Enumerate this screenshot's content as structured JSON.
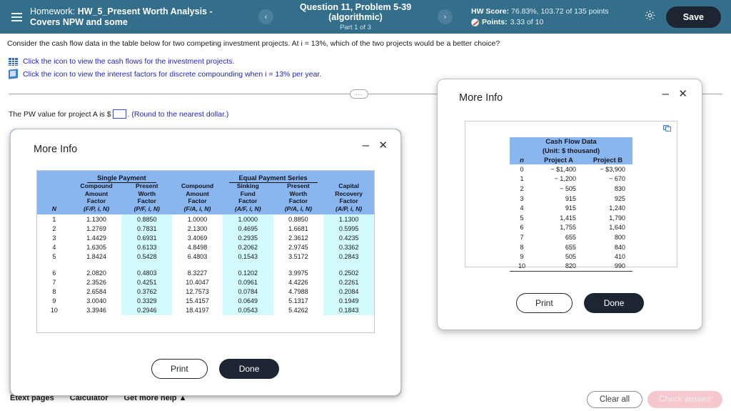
{
  "header": {
    "menu_icon": "hamburger-icon",
    "homework_label": "Homework:",
    "homework_name": "HW_5_Present Worth Analysis - Covers NPW and some",
    "prev_icon": "chevron-left-icon",
    "next_icon": "chevron-right-icon",
    "question_title": "Question 11, Problem 5-39 (algorithmic)",
    "question_part": "Part 1 of 3",
    "hw_score_label": "HW Score:",
    "hw_score_value": "76.83%, 103.72 of 135 points",
    "points_label": "Points:",
    "points_value": "3.33 of 10",
    "settings_icon": "gear-icon",
    "save_label": "Save"
  },
  "question": {
    "prompt": "Consider the cash flow data in the table below for two competing investment projects. At i = 13%, which of the two projects would be a better choice?",
    "link_cashflows": "Click the icon to view the cash flows for the investment projects.",
    "link_interest": "Click the icon to view the interest factors for discrete compounding when i = 13% per year.",
    "answer_prefix": "The PW value for project A is $",
    "answer_value": "",
    "answer_suffix": ". (Round to the nearest dollar.)",
    "collapse_dots": "..."
  },
  "footer": {
    "etext_pages": "Etext pages",
    "calculator": "Calculator",
    "get_more_help": "Get more help ▲",
    "clear_all": "Clear all",
    "check_answer": "Check answer"
  },
  "modal_interest": {
    "title": "More Info",
    "minimize_icon": "minimize-icon",
    "close_icon": "close-icon",
    "print_label": "Print",
    "done_label": "Done",
    "group_headers": [
      "Single Payment",
      "Equal Payment Series"
    ],
    "columns": [
      {
        "name": "N",
        "lines": [
          "",
          "",
          "",
          "N"
        ]
      },
      {
        "name": "F/P",
        "lines": [
          "Compound",
          "Amount",
          "Factor",
          "(F/P, i, N)"
        ]
      },
      {
        "name": "P/F",
        "lines": [
          "Present",
          "Worth",
          "Factor",
          "(P/F, i, N)"
        ]
      },
      {
        "name": "F/A",
        "lines": [
          "Compound",
          "Amount",
          "Factor",
          "(F/A, i, N)"
        ]
      },
      {
        "name": "A/F",
        "lines": [
          "Sinking",
          "Fund",
          "Factor",
          "(A/F, i, N)"
        ]
      },
      {
        "name": "P/A",
        "lines": [
          "Present",
          "Worth",
          "Factor",
          "(P/A, i, N)"
        ]
      },
      {
        "name": "A/P",
        "lines": [
          "Capital",
          "Recovery",
          "Factor",
          "(A/P, i, N)"
        ]
      }
    ],
    "rows": [
      [
        "1",
        "1.1300",
        "0.8850",
        "1.0000",
        "1.0000",
        "0.8850",
        "1.1300"
      ],
      [
        "2",
        "1.2769",
        "0.7831",
        "2.1300",
        "0.4695",
        "1.6681",
        "0.5995"
      ],
      [
        "3",
        "1.4429",
        "0.6931",
        "3.4069",
        "0.2935",
        "2.3612",
        "0.4235"
      ],
      [
        "4",
        "1.6305",
        "0.6133",
        "4.8498",
        "0.2062",
        "2.9745",
        "0.3362"
      ],
      [
        "5",
        "1.8424",
        "0.5428",
        "6.4803",
        "0.1543",
        "3.5172",
        "0.2843"
      ],
      [
        "6",
        "2.0820",
        "0.4803",
        "8.3227",
        "0.1202",
        "3.9975",
        "0.2502"
      ],
      [
        "7",
        "2.3526",
        "0.4251",
        "10.4047",
        "0.0961",
        "4.4226",
        "0.2261"
      ],
      [
        "8",
        "2.6584",
        "0.3762",
        "12.7573",
        "0.0784",
        "4.7988",
        "0.2084"
      ],
      [
        "9",
        "3.0040",
        "0.3329",
        "15.4157",
        "0.0649",
        "5.1317",
        "0.1949"
      ],
      [
        "10",
        "3.3946",
        "0.2946",
        "18.4197",
        "0.0543",
        "5.4262",
        "0.1843"
      ]
    ]
  },
  "modal_cashflow": {
    "title": "More Info",
    "minimize_icon": "minimize-icon",
    "close_icon": "close-icon",
    "copy_icon": "copy-icon",
    "print_label": "Print",
    "done_label": "Done",
    "table_title": "Cash Flow Data",
    "table_subtitle": "(Unit: $ thousand)",
    "col_n": "n",
    "col_a": "Project A",
    "col_b": "Project B",
    "rows": [
      [
        "0",
        "− $1,400",
        "− $3,900"
      ],
      [
        "1",
        "− 1,200",
        "− 670"
      ],
      [
        "2",
        "− 505",
        "830"
      ],
      [
        "3",
        "915",
        "925"
      ],
      [
        "4",
        "915",
        "1,240"
      ],
      [
        "5",
        "1,415",
        "1,790"
      ],
      [
        "6",
        "1,755",
        "1,640"
      ],
      [
        "7",
        "655",
        "800"
      ],
      [
        "8",
        "655",
        "840"
      ],
      [
        "9",
        "505",
        "410"
      ],
      [
        "10",
        "820",
        "990"
      ]
    ]
  },
  "colors": {
    "header_bg": "#336e8a",
    "table_header_blue": "#8ab6f0",
    "alt_column": "#d3fafd",
    "dark_button": "#1d2532",
    "link_blue": "#2222cc"
  }
}
